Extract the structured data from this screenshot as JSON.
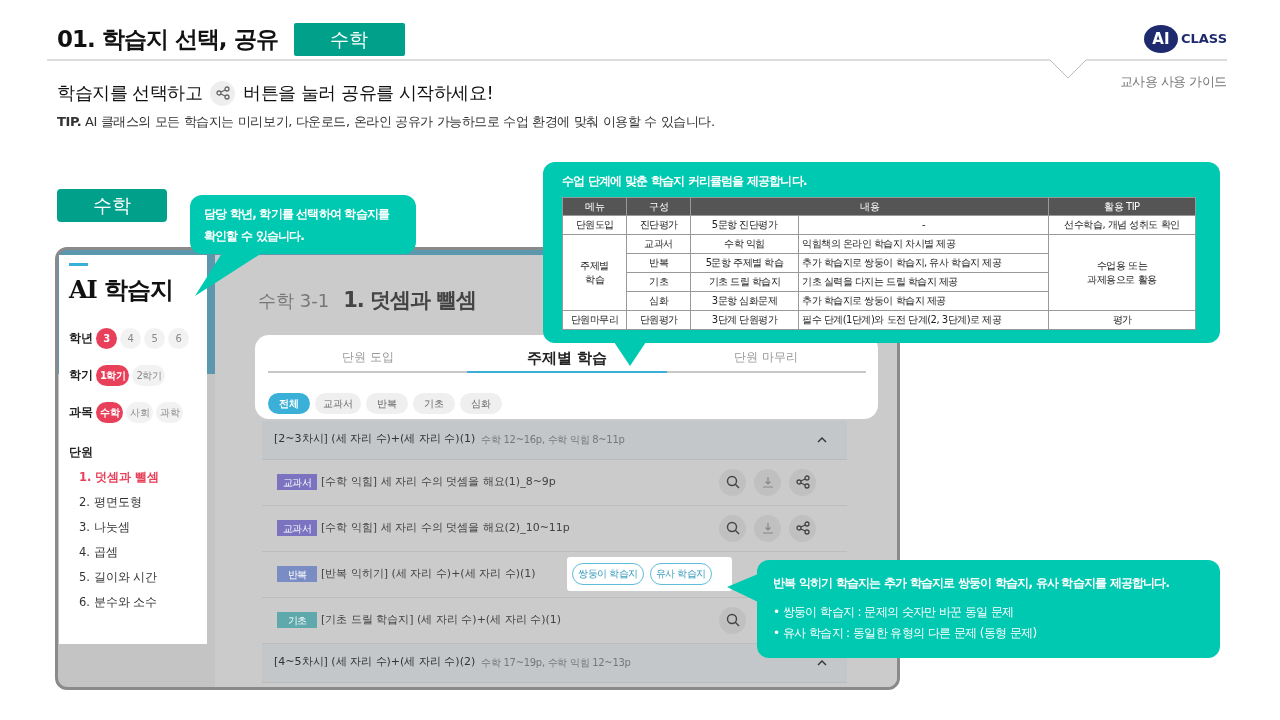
{
  "header": {
    "title": "01. 학습지 선택, 공유",
    "subject_badge": "수학",
    "logo": {
      "mark": "AI",
      "text": "CLASS"
    },
    "guide_label": "교사용 사용 가이드"
  },
  "instruction": {
    "before": "학습지를 선택하고",
    "after": "버튼을 눌러 공유를 시작하세요!"
  },
  "tip": "**TIP.** AI 클래스의 모든 학습지는 미리보기, 다운로드, 온라인 공유가 가능하므로 수업 환경에 맞춰 이용할 수 있습니다.",
  "subject_label": "수학",
  "app": {
    "title": "AI 학습지",
    "filters": [
      {
        "label": "학년",
        "options": [
          {
            "text": "3",
            "selected": true
          },
          {
            "text": "4",
            "selected": false
          },
          {
            "text": "5",
            "selected": false
          },
          {
            "text": "6",
            "selected": false
          }
        ]
      },
      {
        "label": "학기",
        "options": [
          {
            "text": "1학기",
            "selected": true
          },
          {
            "text": "2학기",
            "selected": false
          }
        ]
      },
      {
        "label": "과목",
        "options": [
          {
            "text": "수학",
            "selected": true
          },
          {
            "text": "사회",
            "selected": false
          },
          {
            "text": "과학",
            "selected": false
          }
        ]
      }
    ],
    "units_label": "단원",
    "units": [
      {
        "text": "1. 덧셈과 뺄셈",
        "selected": true
      },
      {
        "text": "2. 평면도형",
        "selected": false
      },
      {
        "text": "3. 나눗셈",
        "selected": false
      },
      {
        "text": "4. 곱셈",
        "selected": false
      },
      {
        "text": "5. 길이와 시간",
        "selected": false
      },
      {
        "text": "6. 분수와 소수",
        "selected": false
      }
    ],
    "course": "수학 3-1",
    "unit_title": "1. 덧셈과 뺄셈",
    "tabs": [
      {
        "label": "단원 도입",
        "selected": false
      },
      {
        "label": "주제별 학습",
        "selected": true
      },
      {
        "label": "단원 마무리",
        "selected": false
      }
    ],
    "chips": [
      {
        "label": "전체",
        "selected": true
      },
      {
        "label": "교과서",
        "selected": false
      },
      {
        "label": "반복",
        "selected": false
      },
      {
        "label": "기초",
        "selected": false
      },
      {
        "label": "심화",
        "selected": false
      }
    ],
    "groups": [
      {
        "title": "[2~3차시] (세 자리 수)+(세 자리 수)(1)",
        "pages": "수학 12~16p, 수학 익힘 8~11p",
        "expanded": true,
        "rows": [
          {
            "tag": "교과서",
            "color": "#7b72c0",
            "title": "[수학 익힘] 세 자리 수의 덧셈을 해요(1)_8~9p",
            "actions": [
              {
                "kind": "preview"
              },
              {
                "kind": "download"
              },
              {
                "kind": "share"
              }
            ]
          },
          {
            "tag": "교과서",
            "color": "#7b72c0",
            "title": "[수학 익힘] 세 자리 수의 덧셈을 해요(2)_10~11p",
            "actions": [
              {
                "kind": "preview"
              },
              {
                "kind": "download"
              },
              {
                "kind": "share"
              }
            ]
          },
          {
            "tag": "반복",
            "color": "#7a8cc4",
            "title": "[반복 익히기] (세 자리 수)+(세 자리 수)(1)",
            "popup": [
              "쌍둥이 학습지",
              "유사 학습지"
            ]
          },
          {
            "tag": "기초",
            "color": "#5fa9ad",
            "title": "[기초 드릴 학습지] (세 자리 수)+(세 자리 수)(1)",
            "actions": [
              {
                "kind": "preview"
              }
            ]
          }
        ]
      },
      {
        "title": "[4~5차시] (세 자리 수)+(세 자리 수)(2)",
        "pages": "수학 17~19p, 수학 익힘 12~13p",
        "expanded": true
      }
    ]
  },
  "callouts": [
    {
      "kind": "text",
      "text": "담당 학년, 학기를 선택하여 학습지를 확인할 수 있습니다."
    },
    {
      "kind": "table",
      "title": "수업 단계에 맞춘 학습지 커리큘럼을 제공합니다.",
      "columns": [
        {
          "label": "메뉴",
          "kind": "single"
        },
        {
          "label": "구성",
          "kind": "single"
        },
        {
          "label": "내용",
          "kind": "double"
        },
        {
          "label": "활용 TIP",
          "kind": "single"
        }
      ],
      "sections": [
        {
          "menu": "단원도입",
          "tip": "선수학습, 개념 성취도 확인",
          "items": [
            {
              "type": "진단평가",
              "name": "5문항 진단평가",
              "content": "-"
            }
          ]
        },
        {
          "menu": "주제별\n학습",
          "tip": "수업용 또는\n과제용으로 활용",
          "items": [
            {
              "type": "교과서",
              "name": "수학 익힘",
              "content": "익힘책의 온라인 학습지 차시별 제공"
            },
            {
              "type": "반복",
              "name": "5문항 주제별 학습",
              "content": "추가 학습지로 쌍둥이 학습지, 유사 학습지 제공"
            },
            {
              "type": "기초",
              "name": "기초 드릴 학습지",
              "content": "기초 실력을 다지는 드릴 학습지 제공"
            },
            {
              "type": "심화",
              "name": "3문항 심화문제",
              "content": "추가 학습지로 쌍둥이 학습지 제공"
            }
          ]
        },
        {
          "menu": "단원마무리",
          "tip": "평가",
          "items": [
            {
              "type": "단원평가",
              "name": "3단계 단원평가",
              "content": "필수 단계(1단계)와 도전 단계(2, 3단계)로 제공"
            }
          ]
        }
      ]
    },
    {
      "kind": "list",
      "title": "반복 익히기 학습지는 추가 학습지로 쌍둥이 학습지, 유사 학습지를 제공합니다.",
      "bullets": [
        "• 쌍둥이 학습지 : 문제의 숫자만 바꾼 동일 문제",
        "• 유사 학습지 : 동일한 유형의 다른 문제 (동형 문제)"
      ]
    }
  ]
}
